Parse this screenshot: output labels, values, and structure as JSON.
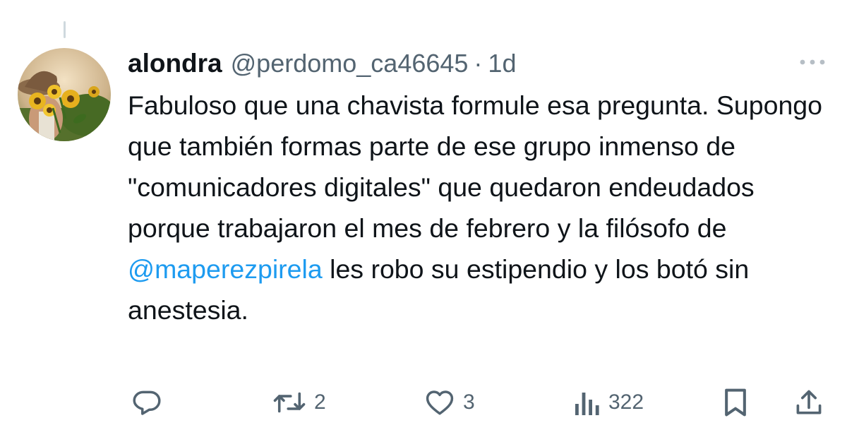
{
  "tweet": {
    "display_name": "alondra",
    "handle": "@perdomo_ca46645",
    "separator": "·",
    "timestamp": "1d",
    "text_before_mention": "Fabuloso que una chavista formule esa pregunta. Supongo que también formas parte de ese grupo inmenso de \"comunicadores digitales\" que quedaron endeudados porque trabajaron el mes de febrero y la filósofo de ",
    "mention": "@maperezpirela",
    "text_after_mention": " les robo su estipendio y los botó sin anestesia."
  },
  "actions": {
    "reply_icon": "reply-icon",
    "retweet_icon": "retweet-icon",
    "retweet_count": "2",
    "like_icon": "heart-icon",
    "like_count": "3",
    "views_icon": "views-icon",
    "views_count": "322",
    "bookmark_icon": "bookmark-icon",
    "share_icon": "share-icon"
  },
  "colors": {
    "text": "#0f1419",
    "secondary": "#536471",
    "link": "#1d9bf0",
    "thread_line": "#cfd9de"
  }
}
